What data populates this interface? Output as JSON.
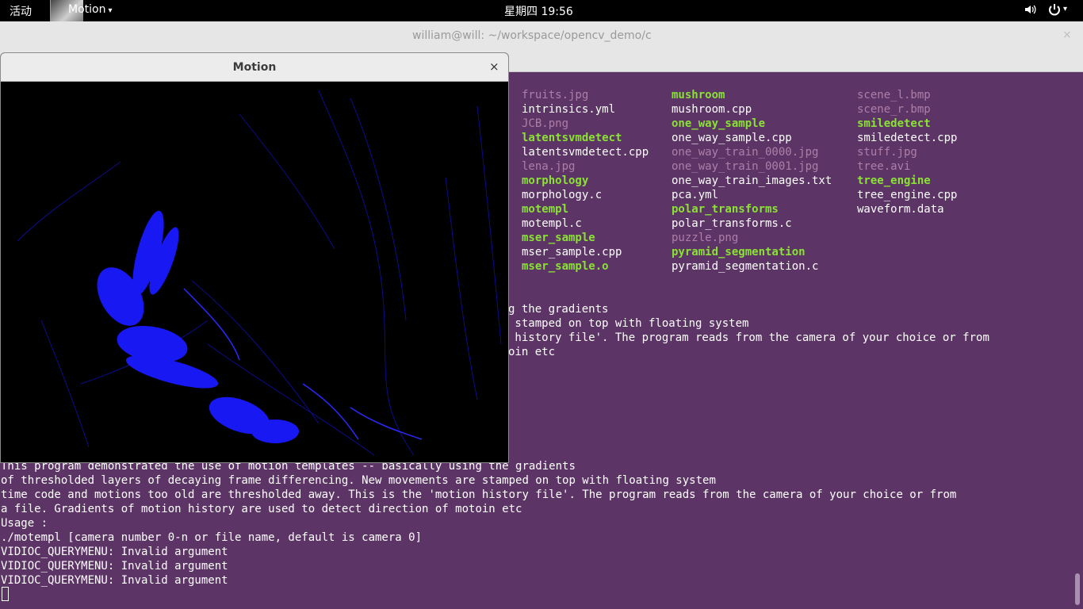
{
  "topbar": {
    "activities": "活动",
    "app_menu": "Motion",
    "app_menu_caret": "▾",
    "clock": "星期四 19:56",
    "volume_icon": "♪",
    "power_icon": "⏻",
    "power_caret": "▾"
  },
  "terminal": {
    "title": "william@will: ~/workspace/opencv_demo/c",
    "close": "×",
    "listing": [
      [
        "fruits.jpg",
        "mushroom",
        "scene_l.bmp"
      ],
      [
        "intrinsics.yml",
        "mushroom.cpp",
        "scene_r.bmp"
      ],
      [
        "JCB.png",
        "one_way_sample",
        "smiledetect"
      ],
      [
        "latentsvmdetect",
        "one_way_sample.cpp",
        "smiledetect.cpp"
      ],
      [
        "latentsvmdetect.cpp",
        "one_way_train_0000.jpg",
        "stuff.jpg"
      ],
      [
        "lena.jpg",
        "one_way_train_0001.jpg",
        "tree.avi"
      ],
      [
        "morphology",
        "one_way_train_images.txt",
        "tree_engine"
      ],
      [
        "morphology.c",
        "pca.yml",
        "tree_engine.cpp"
      ],
      [
        "motempl",
        "polar_transforms",
        "waveform.data"
      ],
      [
        "motempl.c",
        "polar_transforms.c",
        ""
      ],
      [
        "mser_sample",
        "puzzle.png",
        ""
      ],
      [
        "mser_sample.cpp",
        "pyramid_segmentation",
        ""
      ],
      [
        "mser_sample.o",
        "pyramid_segmentation.c",
        ""
      ]
    ],
    "listing_kinds": [
      [
        "img",
        "exe",
        "img"
      ],
      [
        "txt",
        "txt",
        "img"
      ],
      [
        "img",
        "exe",
        "exe"
      ],
      [
        "exe",
        "txt",
        "txt"
      ],
      [
        "txt",
        "img",
        "img"
      ],
      [
        "img",
        "img",
        "img"
      ],
      [
        "exe",
        "txt",
        "exe"
      ],
      [
        "txt",
        "txt",
        "txt"
      ],
      [
        "exe",
        "exe",
        "txt"
      ],
      [
        "txt",
        "txt",
        ""
      ],
      [
        "exe",
        "img",
        ""
      ],
      [
        "txt",
        "exe",
        ""
      ],
      [
        "exe",
        "txt",
        ""
      ]
    ],
    "partial_output": [
      "g the gradients",
      " stamped on top with floating system",
      " history file'. The program reads from the camera of your choice or from",
      "oin etc"
    ],
    "output": [
      "This program demonstrated the use of motion templates -- basically using the gradients",
      "of thresholded layers of decaying frame differencing. New movements are stamped on top with floating system",
      "time code and motions too old are thresholded away. This is the 'motion history file'. The program reads from the camera of your choice or from",
      "a file. Gradients of motion history are used to detect direction of motoin etc",
      "Usage :",
      "./motempl [camera number 0-n or file name, default is camera 0]",
      "VIDIOC_QUERYMENU: Invalid argument",
      "VIDIOC_QUERYMENU: Invalid argument",
      "VIDIOC_QUERYMENU: Invalid argument"
    ]
  },
  "motion_window": {
    "title": "Motion",
    "close": "×"
  },
  "colors": {
    "terminal_bg": "#5c3566",
    "executable": "#8ae234",
    "image": "#ad7fa8",
    "text": "#ffffff",
    "motion_blue": "#1a1aff"
  }
}
